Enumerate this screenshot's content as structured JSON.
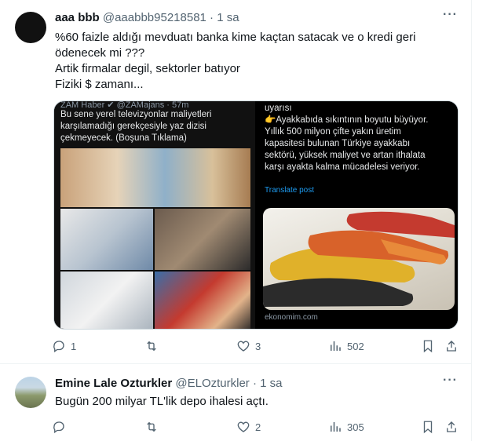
{
  "tweets": [
    {
      "author_name": "aaa bbb",
      "author_meta": "@aaabbb95218581 · 1 sa",
      "text_lines": [
        "%60 faizle aldığı mevduatı banka kime kaçtan satacak ve o kredi geri",
        "ödenecek mi ???",
        "Artik firmalar degil, sektorler batıyor",
        "Fiziki $ zamanı..."
      ],
      "media": {
        "left": {
          "header": "ZAM Haber ✔ @ZAMajans · 57m",
          "text": "Bu sene yerel televizyonlar maliyetleri karşılamadığı gerekçesiyle yaz dizisi çekmeyecek. (Boşuna Tıklama)"
        },
        "right": {
          "text_lines": [
            "uyarısı",
            "👉Ayakkabıda sıkıntının boyutu büyüyor.",
            "Yıllık 500 milyon çifte yakın üretim",
            "kapasitesi bulunan Türkiye ayakkabı",
            "sektörü, yüksek maliyet ve artan ithalata",
            "karşı ayakta kalma mücadelesi veriyor."
          ],
          "translate": "Translate post",
          "source": "ekonomim.com"
        }
      },
      "actions": {
        "reply": "1",
        "retweet": "",
        "like": "3",
        "views": "502"
      }
    },
    {
      "author_name": "Emine Lale Ozturkler",
      "author_meta": "@ELOzturkler · 1 sa",
      "text_lines": [
        "Bugün 200 milyar TL'lik depo ihalesi açtı."
      ],
      "actions": {
        "reply": "",
        "retweet": "",
        "like": "2",
        "views": "305"
      }
    }
  ],
  "colors": {
    "text": "#0f1419",
    "muted": "#536471",
    "link": "#1d9bf0",
    "border": "#eff3f4"
  },
  "icons": [
    "more-icon",
    "reply-icon",
    "retweet-icon",
    "like-icon",
    "views-icon",
    "bookmark-icon",
    "share-icon"
  ]
}
